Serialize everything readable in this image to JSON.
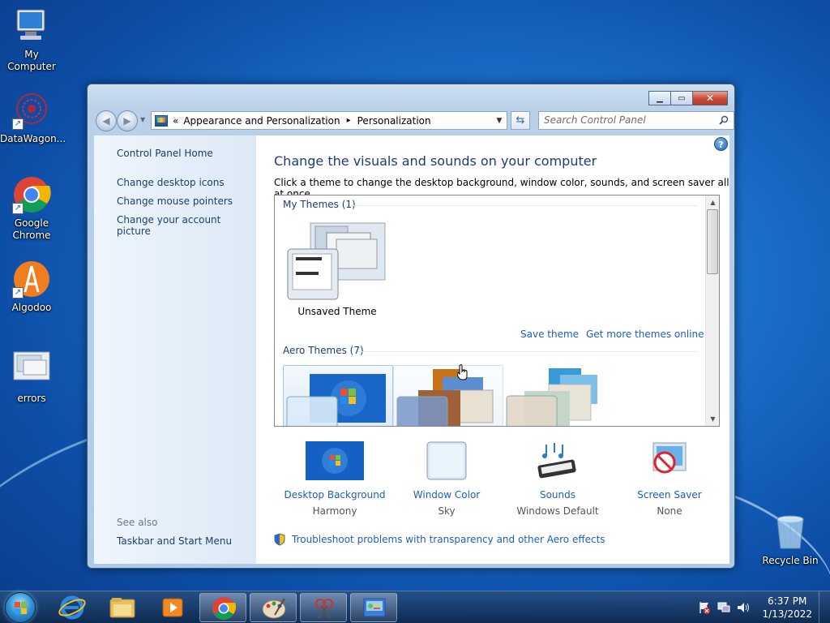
{
  "desktop": {
    "icons": [
      {
        "label": "My Computer"
      },
      {
        "label": "DataWagon..."
      },
      {
        "label": "Google Chrome"
      },
      {
        "label": "Algodoo"
      },
      {
        "label": "errors"
      },
      {
        "label": "Recycle Bin"
      }
    ]
  },
  "window": {
    "address": {
      "overflow": "«",
      "crumb1": "Appearance and Personalization",
      "separator": "▸",
      "crumb2": "Personalization"
    },
    "search_placeholder": "Search Control Panel",
    "left_pane": {
      "home": "Control Panel Home",
      "links": [
        "Change desktop icons",
        "Change mouse pointers",
        "Change your account picture"
      ],
      "see_also": "See also",
      "see_also_links": [
        "Taskbar and Start Menu"
      ]
    },
    "content": {
      "heading": "Change the visuals and sounds on your computer",
      "subheading": "Click a theme to change the desktop background, window color, sounds, and screen saver all at once.",
      "my_themes_title": "My Themes (1)",
      "unsaved_theme": "Unsaved Theme",
      "save_theme": "Save theme",
      "get_more": "Get more themes online",
      "aero_themes_title": "Aero Themes (7)",
      "settings": [
        {
          "title": "Desktop Background",
          "value": "Harmony"
        },
        {
          "title": "Window Color",
          "value": "Sky"
        },
        {
          "title": "Sounds",
          "value": "Windows Default"
        },
        {
          "title": "Screen Saver",
          "value": "None"
        }
      ],
      "troubleshoot": "Troubleshoot problems with transparency and other Aero effects"
    }
  },
  "taskbar": {
    "time": "6:37 PM",
    "date": "1/13/2022"
  }
}
